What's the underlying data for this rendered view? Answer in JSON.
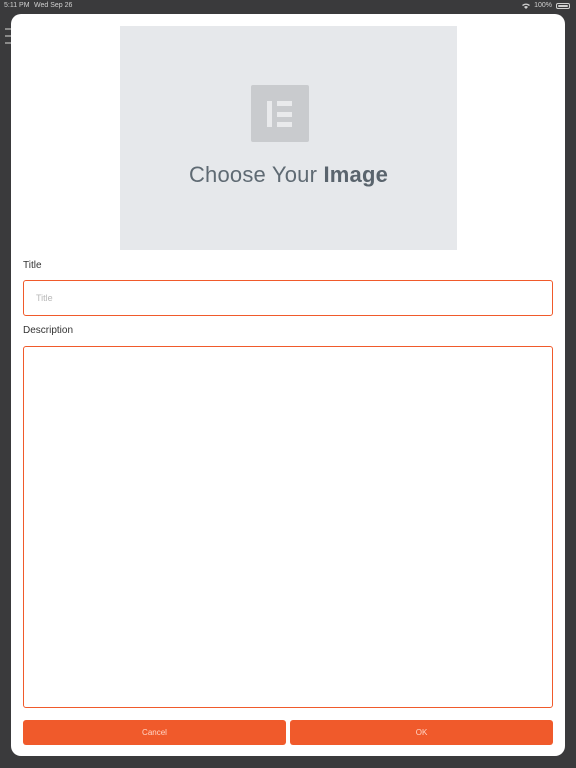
{
  "status_bar": {
    "time": "5:11 PM",
    "date": "Wed Sep 26",
    "battery": "100%",
    "icons": [
      "wifi-icon",
      "battery-icon"
    ]
  },
  "image_picker": {
    "prefix": "Choose Your",
    "emphasis": "Image",
    "icon": "elementor-logo-icon"
  },
  "form": {
    "title_label": "Title",
    "title_placeholder": "Title",
    "title_value": "",
    "description_label": "Description",
    "description_value": ""
  },
  "buttons": {
    "cancel": "Cancel",
    "ok": "OK"
  },
  "colors": {
    "accent": "#f05a2b",
    "placeholder_bg": "#e6e8eb",
    "backdrop": "#3a3a3c"
  }
}
